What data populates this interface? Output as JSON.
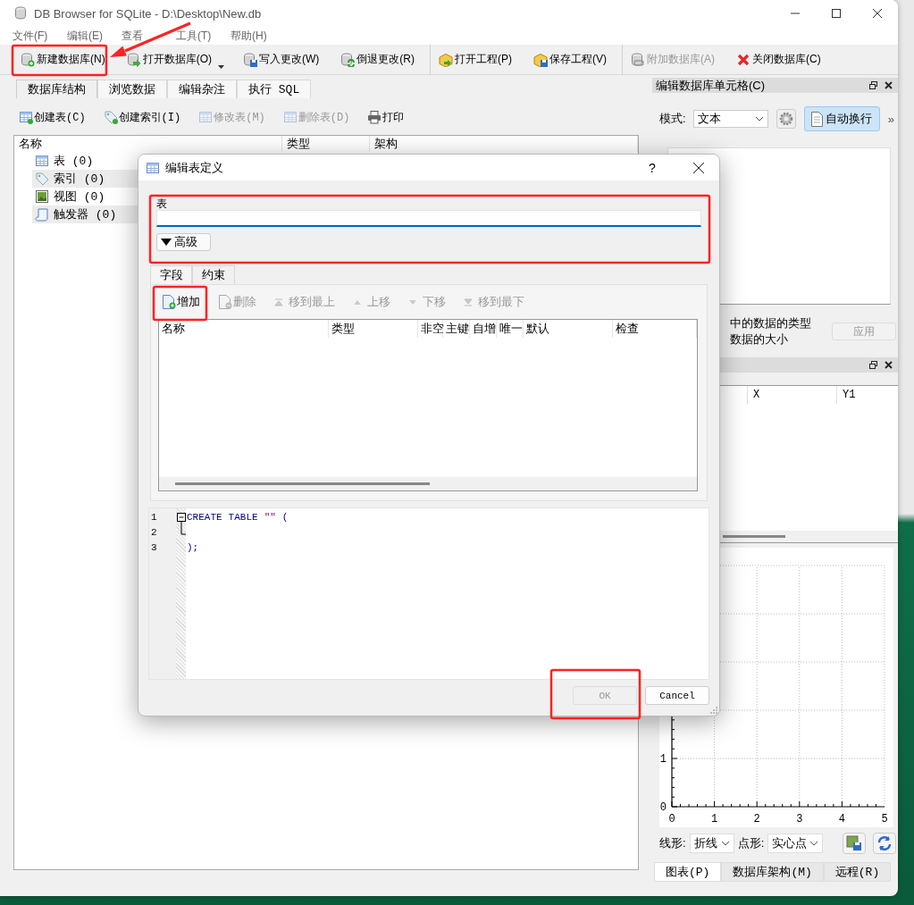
{
  "window": {
    "title": "DB Browser for SQLite - D:\\Desktop\\New.db"
  },
  "menu": [
    {
      "label": "文件(F)"
    },
    {
      "label": "编辑(E)"
    },
    {
      "label": "查看"
    },
    {
      "label": "工具(T)"
    },
    {
      "label": "帮助(H)"
    }
  ],
  "toolbar_groups": [
    [
      {
        "label": "新建数据库(N)",
        "disabled": false
      },
      {
        "label": "打开数据库(O)",
        "disabled": false,
        "dropdown": true
      },
      {
        "label": "写入更改(W)",
        "disabled": false
      },
      {
        "label": "倒退更改(R)",
        "disabled": false
      }
    ],
    [
      {
        "label": "打开工程(P)",
        "disabled": false
      },
      {
        "label": "保存工程(V)",
        "disabled": false
      }
    ],
    [
      {
        "label": "附加数据库(A)",
        "disabled": true
      },
      {
        "label": "关闭数据库(C)",
        "disabled": false
      }
    ]
  ],
  "main_tabs": [
    {
      "label": "数据库结构",
      "selected": true
    },
    {
      "label": "浏览数据",
      "selected": false
    },
    {
      "label": "编辑杂注",
      "selected": false
    },
    {
      "label": "执行 SQL",
      "selected": false
    }
  ],
  "structure_toolbar": [
    {
      "label": "创建表(C)",
      "disabled": false
    },
    {
      "label": "创建索引(I)",
      "disabled": false
    },
    {
      "label": "修改表(M)",
      "disabled": true
    },
    {
      "label": "删除表(D)",
      "disabled": true
    },
    {
      "label": "打印",
      "disabled": false
    }
  ],
  "tree": {
    "columns": [
      "名称",
      "类型",
      "架构"
    ],
    "items": [
      {
        "label": "表 (0)"
      },
      {
        "label": "索引 (0)"
      },
      {
        "label": "视图 (0)"
      },
      {
        "label": "触发器 (0)"
      }
    ]
  },
  "cell_editor": {
    "title": "编辑数据库单元格(C)",
    "mode_label": "模式:",
    "mode": "文本",
    "word_wrap": {
      "label": "自动换行",
      "on": true
    },
    "overflow": "»",
    "info_lines": [
      "中的数据的类型",
      "数据的大小"
    ],
    "apply": {
      "label": "应用",
      "disabled": true
    }
  },
  "plot": {
    "columns": [
      "X",
      "Y1"
    ],
    "chart_data": {
      "type": "line",
      "grid": true,
      "xlim": [
        0,
        5
      ],
      "ylim": [
        0,
        5
      ],
      "xticks": [
        0,
        1,
        2,
        3,
        4,
        5
      ],
      "yticks": [
        0,
        1
      ]
    },
    "line_type_label": "线形:",
    "line_type": "折线",
    "point_label": "点形:",
    "point_shape": "实心点"
  },
  "dock_tabs": [
    {
      "label": "图表(P)",
      "selected": true
    },
    {
      "label": "数据库架构(M)",
      "selected": false
    },
    {
      "label": "远程(R)",
      "selected": false
    }
  ],
  "dialog": {
    "title": "编辑表定义",
    "help": "?",
    "table_label": "表",
    "advanced": "高级",
    "tabs": [
      {
        "label": "字段",
        "selected": true
      },
      {
        "label": "约束",
        "selected": false
      }
    ],
    "field_toolbar": [
      {
        "label": "增加",
        "disabled": false
      },
      {
        "label": "删除",
        "disabled": true
      },
      {
        "label": "移到最上",
        "disabled": true
      },
      {
        "label": "上移",
        "disabled": true
      },
      {
        "label": "下移",
        "disabled": true
      },
      {
        "label": "移到最下",
        "disabled": true
      }
    ],
    "field_columns": [
      "名称",
      "类型",
      "非空",
      "主键",
      "自增",
      "唯一",
      "默认",
      "检查"
    ],
    "sql": [
      {
        "number": "1",
        "fold_start": true,
        "tokens": [
          {
            "text": "CREATE",
            "kind": "keyword"
          },
          {
            "text": "TABLE",
            "kind": "keyword"
          },
          {
            "text": "\"\"",
            "kind": "string"
          },
          {
            "text": "(",
            "kind": "operator"
          }
        ]
      },
      {
        "number": "2",
        "fold_start": false
      },
      {
        "number": "3",
        "fold_start": false,
        "tokens": [
          {
            "text": ");",
            "kind": "operator"
          }
        ]
      }
    ],
    "buttons": [
      {
        "label": "OK",
        "disabled": true
      },
      {
        "label": "Cancel",
        "disabled": false
      }
    ]
  }
}
